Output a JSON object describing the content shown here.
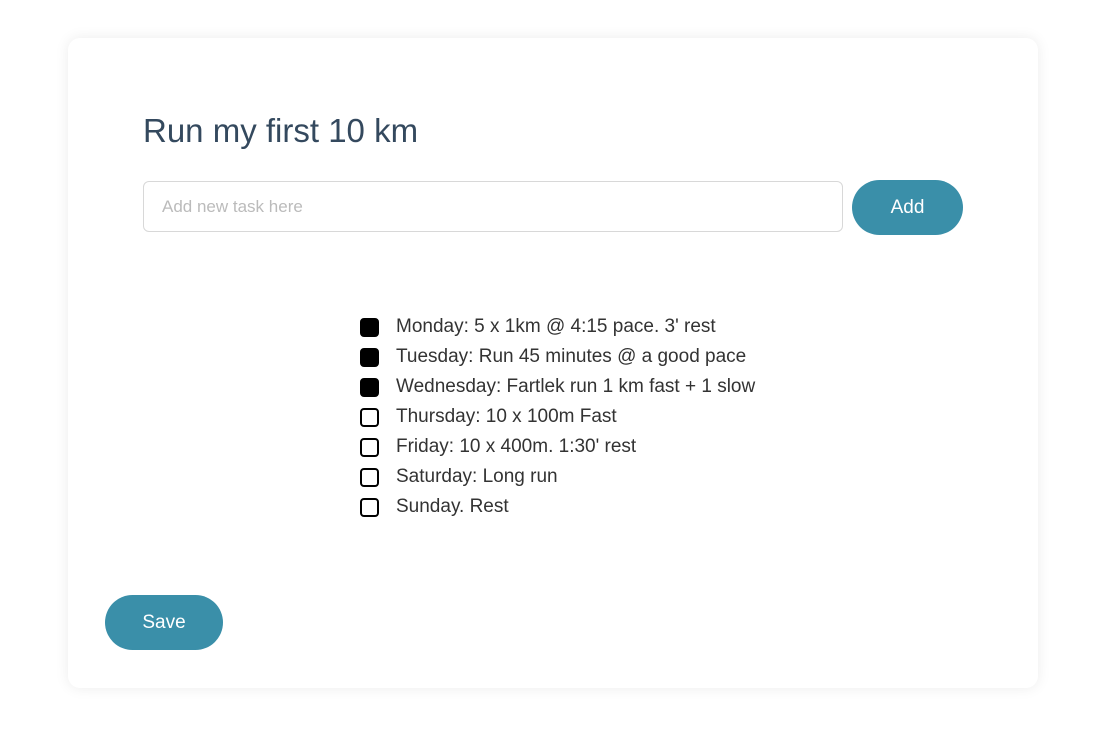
{
  "accent_color": "#3a8fa9",
  "title": "Run my first 10 km",
  "new_task": {
    "value": "",
    "placeholder": "Add new task here"
  },
  "add_label": "Add",
  "save_label": "Save",
  "tasks": [
    {
      "label": "Monday: 5 x 1km @ 4:15 pace. 3' rest",
      "checked": true
    },
    {
      "label": "Tuesday: Run 45 minutes @ a good pace",
      "checked": true
    },
    {
      "label": "Wednesday: Fartlek run 1 km fast + 1 slow",
      "checked": true
    },
    {
      "label": "Thursday: 10 x 100m Fast",
      "checked": false
    },
    {
      "label": "Friday: 10 x 400m. 1:30' rest",
      "checked": false
    },
    {
      "label": "Saturday: Long run",
      "checked": false
    },
    {
      "label": "Sunday. Rest",
      "checked": false
    }
  ]
}
